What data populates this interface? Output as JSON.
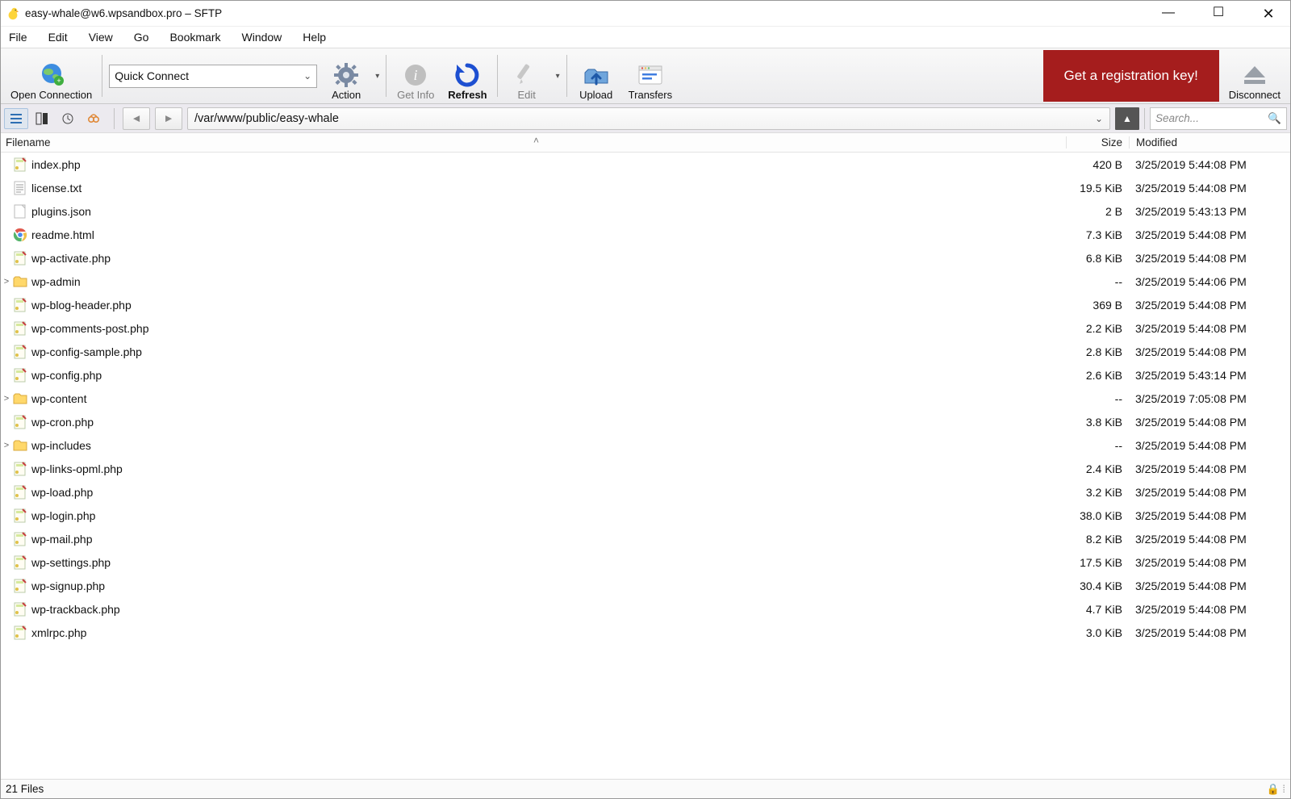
{
  "window": {
    "title": "easy-whale@w6.wpsandbox.pro – SFTP"
  },
  "menu": [
    "File",
    "Edit",
    "View",
    "Go",
    "Bookmark",
    "Window",
    "Help"
  ],
  "toolbar": {
    "open_connection": "Open Connection",
    "quick_connect": "Quick Connect",
    "action": "Action",
    "get_info": "Get Info",
    "refresh": "Refresh",
    "edit": "Edit",
    "upload": "Upload",
    "transfers": "Transfers",
    "registration": "Get a registration key!",
    "disconnect": "Disconnect"
  },
  "pathbar": {
    "path": "/var/www/public/easy-whale",
    "search_placeholder": "Search..."
  },
  "columns": {
    "filename": "Filename",
    "size": "Size",
    "modified": "Modified"
  },
  "files": [
    {
      "expand": "",
      "icon": "php",
      "name": "index.php",
      "size": "420 B",
      "modified": "3/25/2019 5:44:08 PM"
    },
    {
      "expand": "",
      "icon": "txt",
      "name": "license.txt",
      "size": "19.5 KiB",
      "modified": "3/25/2019 5:44:08 PM"
    },
    {
      "expand": "",
      "icon": "blank",
      "name": "plugins.json",
      "size": "2 B",
      "modified": "3/25/2019 5:43:13 PM"
    },
    {
      "expand": "",
      "icon": "chrome",
      "name": "readme.html",
      "size": "7.3 KiB",
      "modified": "3/25/2019 5:44:08 PM"
    },
    {
      "expand": "",
      "icon": "php",
      "name": "wp-activate.php",
      "size": "6.8 KiB",
      "modified": "3/25/2019 5:44:08 PM"
    },
    {
      "expand": ">",
      "icon": "folder",
      "name": "wp-admin",
      "size": "--",
      "modified": "3/25/2019 5:44:06 PM"
    },
    {
      "expand": "",
      "icon": "php",
      "name": "wp-blog-header.php",
      "size": "369 B",
      "modified": "3/25/2019 5:44:08 PM"
    },
    {
      "expand": "",
      "icon": "php",
      "name": "wp-comments-post.php",
      "size": "2.2 KiB",
      "modified": "3/25/2019 5:44:08 PM"
    },
    {
      "expand": "",
      "icon": "php",
      "name": "wp-config-sample.php",
      "size": "2.8 KiB",
      "modified": "3/25/2019 5:44:08 PM"
    },
    {
      "expand": "",
      "icon": "php",
      "name": "wp-config.php",
      "size": "2.6 KiB",
      "modified": "3/25/2019 5:43:14 PM"
    },
    {
      "expand": ">",
      "icon": "folder",
      "name": "wp-content",
      "size": "--",
      "modified": "3/25/2019 7:05:08 PM"
    },
    {
      "expand": "",
      "icon": "php",
      "name": "wp-cron.php",
      "size": "3.8 KiB",
      "modified": "3/25/2019 5:44:08 PM"
    },
    {
      "expand": ">",
      "icon": "folder",
      "name": "wp-includes",
      "size": "--",
      "modified": "3/25/2019 5:44:08 PM"
    },
    {
      "expand": "",
      "icon": "php",
      "name": "wp-links-opml.php",
      "size": "2.4 KiB",
      "modified": "3/25/2019 5:44:08 PM"
    },
    {
      "expand": "",
      "icon": "php",
      "name": "wp-load.php",
      "size": "3.2 KiB",
      "modified": "3/25/2019 5:44:08 PM"
    },
    {
      "expand": "",
      "icon": "php",
      "name": "wp-login.php",
      "size": "38.0 KiB",
      "modified": "3/25/2019 5:44:08 PM"
    },
    {
      "expand": "",
      "icon": "php",
      "name": "wp-mail.php",
      "size": "8.2 KiB",
      "modified": "3/25/2019 5:44:08 PM"
    },
    {
      "expand": "",
      "icon": "php",
      "name": "wp-settings.php",
      "size": "17.5 KiB",
      "modified": "3/25/2019 5:44:08 PM"
    },
    {
      "expand": "",
      "icon": "php",
      "name": "wp-signup.php",
      "size": "30.4 KiB",
      "modified": "3/25/2019 5:44:08 PM"
    },
    {
      "expand": "",
      "icon": "php",
      "name": "wp-trackback.php",
      "size": "4.7 KiB",
      "modified": "3/25/2019 5:44:08 PM"
    },
    {
      "expand": "",
      "icon": "php",
      "name": "xmlrpc.php",
      "size": "3.0 KiB",
      "modified": "3/25/2019 5:44:08 PM"
    }
  ],
  "status": {
    "left": "21 Files"
  }
}
